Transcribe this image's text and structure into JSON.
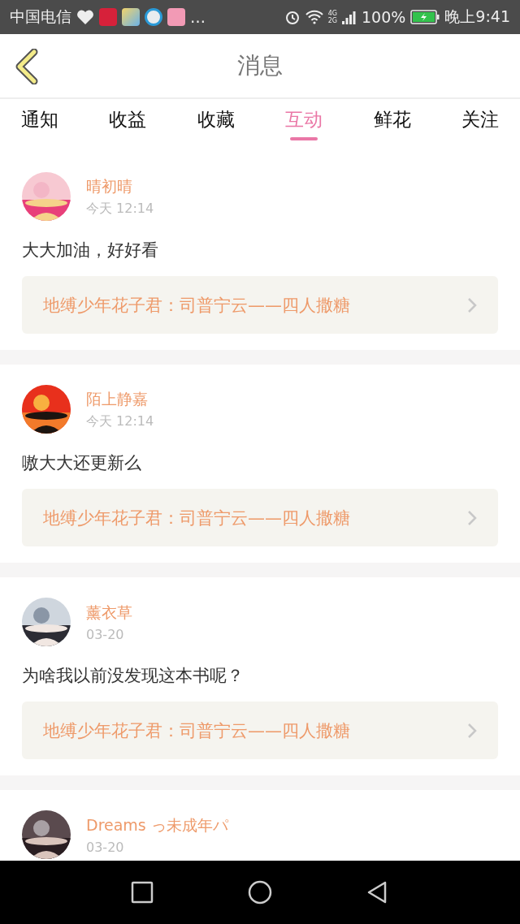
{
  "status_bar": {
    "carrier": "中国电信",
    "more": "…",
    "network": [
      "4G",
      "2G"
    ],
    "battery": "100%",
    "time": "晚上9:41"
  },
  "header": {
    "title": "消息"
  },
  "tabs": [
    {
      "label": "通知",
      "selected": false
    },
    {
      "label": "收益",
      "selected": false
    },
    {
      "label": "收藏",
      "selected": false
    },
    {
      "label": "互动",
      "selected": true
    },
    {
      "label": "鲜花",
      "selected": false
    },
    {
      "label": "关注",
      "selected": false
    }
  ],
  "messages": [
    {
      "name": "晴初晴",
      "time": "今天 12:14",
      "comment": "大大加油，好好看",
      "link": "地缚少年花子君：司普宁云——四人撒糖"
    },
    {
      "name": "陌上静嘉",
      "time": "今天 12:14",
      "comment": "嗷大大还更新么",
      "link": "地缚少年花子君：司普宁云——四人撒糖"
    },
    {
      "name": "薰衣草",
      "time": "03-20",
      "comment": "为啥我以前没发现这本书呢？",
      "link": "地缚少年花子君：司普宁云——四人撒糖"
    },
    {
      "name": "Dreams っ未成年パ",
      "time": "03-20"
    }
  ]
}
